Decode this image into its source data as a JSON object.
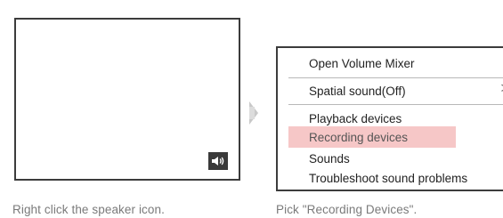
{
  "left_panel": {
    "caption": "Right click the speaker icon."
  },
  "context_menu": {
    "items": [
      {
        "label": "Open Volume Mixer"
      },
      {
        "label": "Spatial sound(Off)",
        "submenu_indicator": ">"
      },
      {
        "label": "Playback devices"
      },
      {
        "label": "Recording devices",
        "highlighted": true
      },
      {
        "label": "Sounds"
      },
      {
        "label": "Troubleshoot sound problems"
      }
    ]
  },
  "right_panel": {
    "caption": "Pick \"Recording Devices\"."
  },
  "colors": {
    "frame": "#3c3c3c",
    "highlight": "#f6c7c7",
    "caption_text": "#7a7a7a",
    "arrow": "#c9c9c9"
  },
  "icons": {
    "speaker": "speaker-icon",
    "step_arrow": "arrow-right-icon",
    "submenu": "chevron-right-icon"
  }
}
